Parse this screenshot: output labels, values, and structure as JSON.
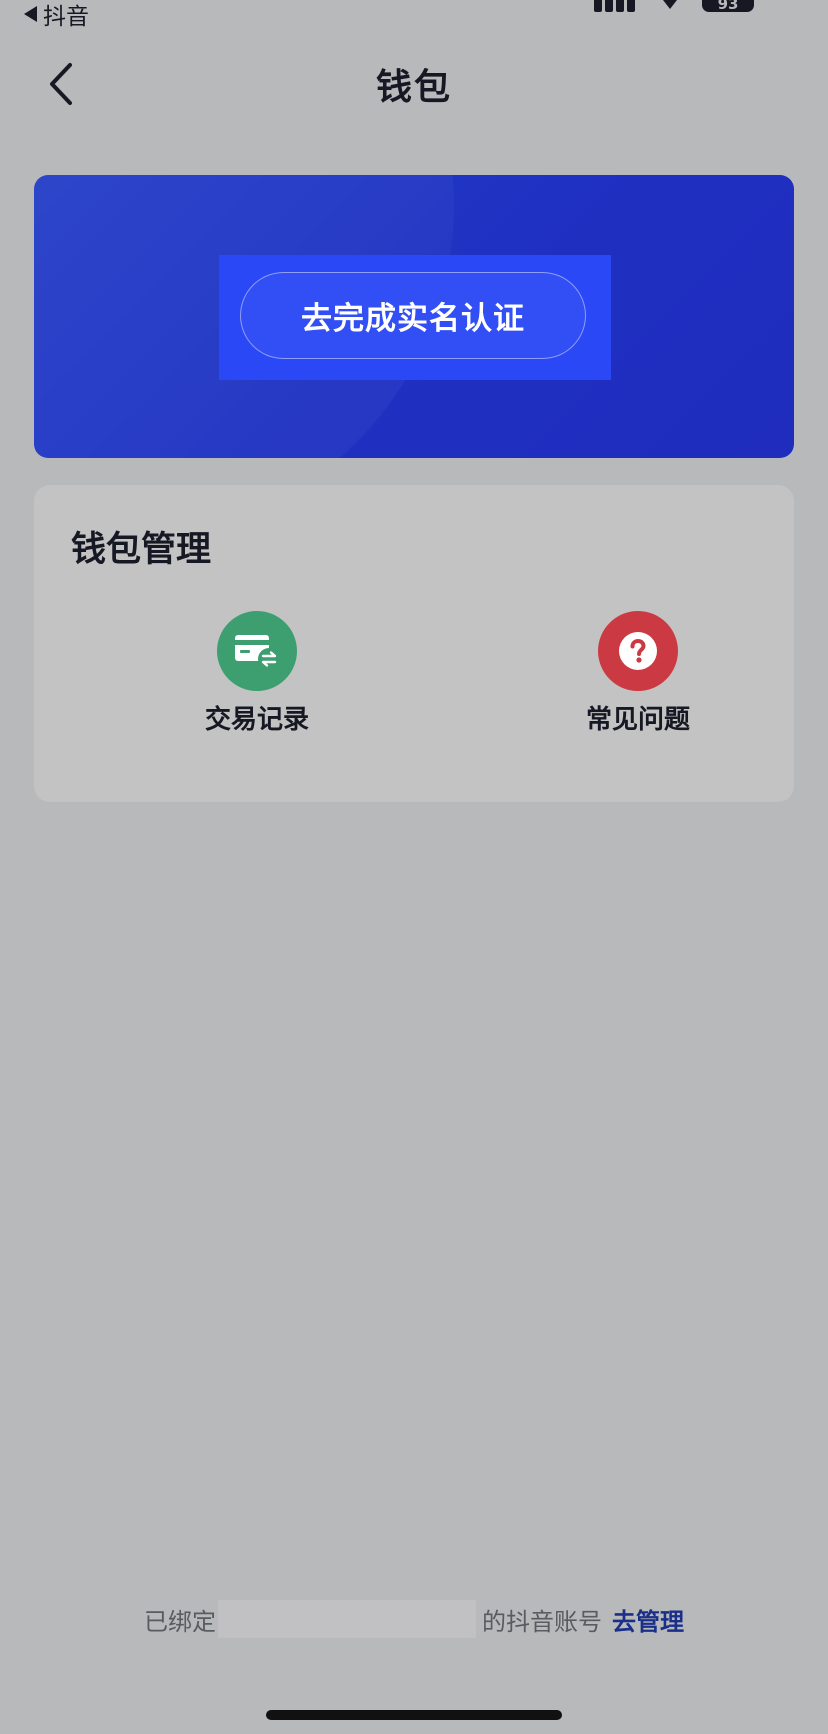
{
  "status_bar": {
    "back_app_label": "抖音",
    "battery_level": "93"
  },
  "nav": {
    "title": "钱包"
  },
  "hero": {
    "verify_button_label": "去完成实名认证"
  },
  "wallet_management": {
    "title": "钱包管理",
    "entries": [
      {
        "label": "交易记录",
        "icon": "transaction-record-icon",
        "color": "#3d9e70"
      },
      {
        "label": "常见问题",
        "icon": "question-icon",
        "color": "#cb3a43"
      }
    ]
  },
  "footer": {
    "bound_prefix": "已绑定",
    "bound_suffix": "的抖音账号",
    "manage_link": "去管理"
  },
  "colors": {
    "background": "#b8b9bb",
    "hero_blue": "#1f31c2",
    "accent_link": "#1b2f8a"
  }
}
